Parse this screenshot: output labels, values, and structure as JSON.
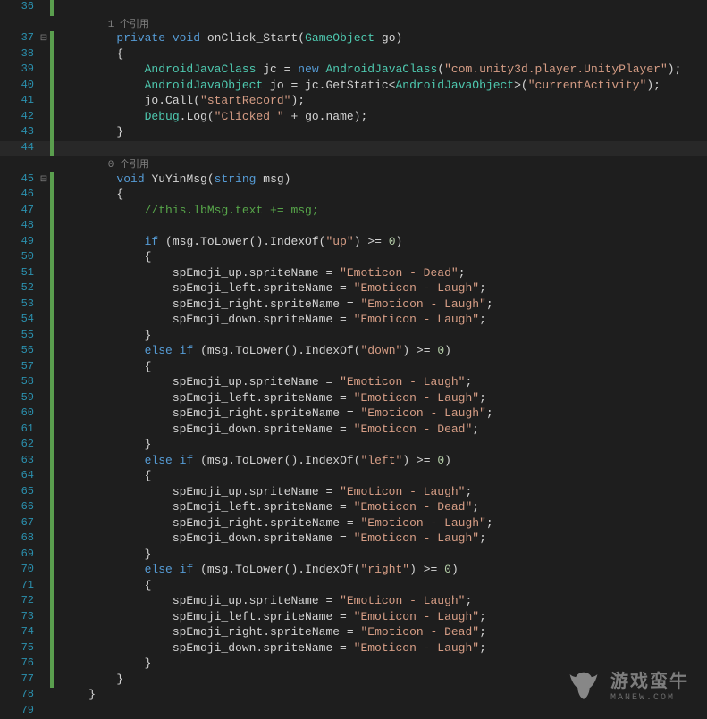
{
  "refs": {
    "r1": "1 个引用",
    "r0": "0 个引用"
  },
  "watermark": {
    "main": "游戏蛮牛",
    "sub": "MANEW.COM"
  },
  "lines": [
    {
      "n": "36",
      "fold": "",
      "bar": "g",
      "tokens": []
    },
    {
      "n": "",
      "fold": "",
      "bar": "",
      "ref": "r1",
      "indent": "        "
    },
    {
      "n": "37",
      "fold": "⊟",
      "bar": "g",
      "tokens": [
        {
          "t": "        "
        },
        {
          "t": "private",
          "c": "kw"
        },
        {
          "t": " "
        },
        {
          "t": "void",
          "c": "kw"
        },
        {
          "t": " onClick_Start("
        },
        {
          "t": "GameObject",
          "c": "type"
        },
        {
          "t": " go)"
        }
      ]
    },
    {
      "n": "38",
      "fold": "",
      "bar": "g",
      "tokens": [
        {
          "t": "        {"
        }
      ]
    },
    {
      "n": "39",
      "fold": "",
      "bar": "g",
      "tokens": [
        {
          "t": "            "
        },
        {
          "t": "AndroidJavaClass",
          "c": "type"
        },
        {
          "t": " jc = "
        },
        {
          "t": "new",
          "c": "kw"
        },
        {
          "t": " "
        },
        {
          "t": "AndroidJavaClass",
          "c": "type"
        },
        {
          "t": "("
        },
        {
          "t": "\"com.unity3d.player.UnityPlayer\"",
          "c": "str"
        },
        {
          "t": ");"
        }
      ]
    },
    {
      "n": "40",
      "fold": "",
      "bar": "g",
      "tokens": [
        {
          "t": "            "
        },
        {
          "t": "AndroidJavaObject",
          "c": "type"
        },
        {
          "t": " jo = jc.GetStatic<"
        },
        {
          "t": "AndroidJavaObject",
          "c": "type"
        },
        {
          "t": ">("
        },
        {
          "t": "\"currentActivity\"",
          "c": "str"
        },
        {
          "t": ");"
        }
      ]
    },
    {
      "n": "41",
      "fold": "",
      "bar": "g",
      "tokens": [
        {
          "t": "            jo.Call("
        },
        {
          "t": "\"startRecord\"",
          "c": "str"
        },
        {
          "t": ");"
        }
      ]
    },
    {
      "n": "42",
      "fold": "",
      "bar": "g",
      "tokens": [
        {
          "t": "            "
        },
        {
          "t": "Debug",
          "c": "type"
        },
        {
          "t": ".Log("
        },
        {
          "t": "\"Clicked \"",
          "c": "str"
        },
        {
          "t": " + go.name);"
        }
      ]
    },
    {
      "n": "43",
      "fold": "",
      "bar": "g",
      "tokens": [
        {
          "t": "        }"
        }
      ]
    },
    {
      "n": "44",
      "fold": "",
      "bar": "g",
      "hl": true,
      "tokens": [
        {
          "t": ""
        }
      ]
    },
    {
      "n": "",
      "fold": "",
      "bar": "",
      "ref": "r0",
      "indent": "        "
    },
    {
      "n": "45",
      "fold": "⊟",
      "bar": "g",
      "tokens": [
        {
          "t": "        "
        },
        {
          "t": "void",
          "c": "kw"
        },
        {
          "t": " YuYinMsg("
        },
        {
          "t": "string",
          "c": "kw"
        },
        {
          "t": " msg)"
        }
      ]
    },
    {
      "n": "46",
      "fold": "",
      "bar": "g",
      "tokens": [
        {
          "t": "        {"
        }
      ]
    },
    {
      "n": "47",
      "fold": "",
      "bar": "g",
      "tokens": [
        {
          "t": "            "
        },
        {
          "t": "//this.lbMsg.text += msg;",
          "c": "comment"
        }
      ]
    },
    {
      "n": "48",
      "fold": "",
      "bar": "g",
      "tokens": [
        {
          "t": ""
        }
      ]
    },
    {
      "n": "49",
      "fold": "",
      "bar": "g",
      "tokens": [
        {
          "t": "            "
        },
        {
          "t": "if",
          "c": "kw"
        },
        {
          "t": " (msg.ToLower().IndexOf("
        },
        {
          "t": "\"up\"",
          "c": "str"
        },
        {
          "t": ") >= "
        },
        {
          "t": "0",
          "c": "num"
        },
        {
          "t": ")"
        }
      ]
    },
    {
      "n": "50",
      "fold": "",
      "bar": "g",
      "tokens": [
        {
          "t": "            {"
        }
      ]
    },
    {
      "n": "51",
      "fold": "",
      "bar": "g",
      "tokens": [
        {
          "t": "                spEmoji_up.spriteName = "
        },
        {
          "t": "\"Emoticon - Dead\"",
          "c": "str"
        },
        {
          "t": ";"
        }
      ]
    },
    {
      "n": "52",
      "fold": "",
      "bar": "g",
      "tokens": [
        {
          "t": "                spEmoji_left.spriteName = "
        },
        {
          "t": "\"Emoticon - Laugh\"",
          "c": "str"
        },
        {
          "t": ";"
        }
      ]
    },
    {
      "n": "53",
      "fold": "",
      "bar": "g",
      "tokens": [
        {
          "t": "                spEmoji_right.spriteName = "
        },
        {
          "t": "\"Emoticon - Laugh\"",
          "c": "str"
        },
        {
          "t": ";"
        }
      ]
    },
    {
      "n": "54",
      "fold": "",
      "bar": "g",
      "tokens": [
        {
          "t": "                spEmoji_down.spriteName = "
        },
        {
          "t": "\"Emoticon - Laugh\"",
          "c": "str"
        },
        {
          "t": ";"
        }
      ]
    },
    {
      "n": "55",
      "fold": "",
      "bar": "g",
      "tokens": [
        {
          "t": "            }"
        }
      ]
    },
    {
      "n": "56",
      "fold": "",
      "bar": "g",
      "tokens": [
        {
          "t": "            "
        },
        {
          "t": "else",
          "c": "kw"
        },
        {
          "t": " "
        },
        {
          "t": "if",
          "c": "kw"
        },
        {
          "t": " (msg.ToLower().IndexOf("
        },
        {
          "t": "\"down\"",
          "c": "str"
        },
        {
          "t": ") >= "
        },
        {
          "t": "0",
          "c": "num"
        },
        {
          "t": ")"
        }
      ]
    },
    {
      "n": "57",
      "fold": "",
      "bar": "g",
      "tokens": [
        {
          "t": "            {"
        }
      ]
    },
    {
      "n": "58",
      "fold": "",
      "bar": "g",
      "tokens": [
        {
          "t": "                spEmoji_up.spriteName = "
        },
        {
          "t": "\"Emoticon - Laugh\"",
          "c": "str"
        },
        {
          "t": ";"
        }
      ]
    },
    {
      "n": "59",
      "fold": "",
      "bar": "g",
      "tokens": [
        {
          "t": "                spEmoji_left.spriteName = "
        },
        {
          "t": "\"Emoticon - Laugh\"",
          "c": "str"
        },
        {
          "t": ";"
        }
      ]
    },
    {
      "n": "60",
      "fold": "",
      "bar": "g",
      "tokens": [
        {
          "t": "                spEmoji_right.spriteName = "
        },
        {
          "t": "\"Emoticon - Laugh\"",
          "c": "str"
        },
        {
          "t": ";"
        }
      ]
    },
    {
      "n": "61",
      "fold": "",
      "bar": "g",
      "tokens": [
        {
          "t": "                spEmoji_down.spriteName = "
        },
        {
          "t": "\"Emoticon - Dead\"",
          "c": "str"
        },
        {
          "t": ";"
        }
      ]
    },
    {
      "n": "62",
      "fold": "",
      "bar": "g",
      "tokens": [
        {
          "t": "            }"
        }
      ]
    },
    {
      "n": "63",
      "fold": "",
      "bar": "g",
      "tokens": [
        {
          "t": "            "
        },
        {
          "t": "else",
          "c": "kw"
        },
        {
          "t": " "
        },
        {
          "t": "if",
          "c": "kw"
        },
        {
          "t": " (msg.ToLower().IndexOf("
        },
        {
          "t": "\"left\"",
          "c": "str"
        },
        {
          "t": ") >= "
        },
        {
          "t": "0",
          "c": "num"
        },
        {
          "t": ")"
        }
      ]
    },
    {
      "n": "64",
      "fold": "",
      "bar": "g",
      "tokens": [
        {
          "t": "            {"
        }
      ]
    },
    {
      "n": "65",
      "fold": "",
      "bar": "g",
      "tokens": [
        {
          "t": "                spEmoji_up.spriteName = "
        },
        {
          "t": "\"Emoticon - Laugh\"",
          "c": "str"
        },
        {
          "t": ";"
        }
      ]
    },
    {
      "n": "66",
      "fold": "",
      "bar": "g",
      "tokens": [
        {
          "t": "                spEmoji_left.spriteName = "
        },
        {
          "t": "\"Emoticon - Dead\"",
          "c": "str"
        },
        {
          "t": ";"
        }
      ]
    },
    {
      "n": "67",
      "fold": "",
      "bar": "g",
      "tokens": [
        {
          "t": "                spEmoji_right.spriteName = "
        },
        {
          "t": "\"Emoticon - Laugh\"",
          "c": "str"
        },
        {
          "t": ";"
        }
      ]
    },
    {
      "n": "68",
      "fold": "",
      "bar": "g",
      "tokens": [
        {
          "t": "                spEmoji_down.spriteName = "
        },
        {
          "t": "\"Emoticon - Laugh\"",
          "c": "str"
        },
        {
          "t": ";"
        }
      ]
    },
    {
      "n": "69",
      "fold": "",
      "bar": "g",
      "tokens": [
        {
          "t": "            }"
        }
      ]
    },
    {
      "n": "70",
      "fold": "",
      "bar": "g",
      "tokens": [
        {
          "t": "            "
        },
        {
          "t": "else",
          "c": "kw"
        },
        {
          "t": " "
        },
        {
          "t": "if",
          "c": "kw"
        },
        {
          "t": " (msg.ToLower().IndexOf("
        },
        {
          "t": "\"right\"",
          "c": "str"
        },
        {
          "t": ") >= "
        },
        {
          "t": "0",
          "c": "num"
        },
        {
          "t": ")"
        }
      ]
    },
    {
      "n": "71",
      "fold": "",
      "bar": "g",
      "tokens": [
        {
          "t": "            {"
        }
      ]
    },
    {
      "n": "72",
      "fold": "",
      "bar": "g",
      "tokens": [
        {
          "t": "                spEmoji_up.spriteName = "
        },
        {
          "t": "\"Emoticon - Laugh\"",
          "c": "str"
        },
        {
          "t": ";"
        }
      ]
    },
    {
      "n": "73",
      "fold": "",
      "bar": "g",
      "tokens": [
        {
          "t": "                spEmoji_left.spriteName = "
        },
        {
          "t": "\"Emoticon - Laugh\"",
          "c": "str"
        },
        {
          "t": ";"
        }
      ]
    },
    {
      "n": "74",
      "fold": "",
      "bar": "g",
      "tokens": [
        {
          "t": "                spEmoji_right.spriteName = "
        },
        {
          "t": "\"Emoticon - Dead\"",
          "c": "str"
        },
        {
          "t": ";"
        }
      ]
    },
    {
      "n": "75",
      "fold": "",
      "bar": "g",
      "tokens": [
        {
          "t": "                spEmoji_down.spriteName = "
        },
        {
          "t": "\"Emoticon - Laugh\"",
          "c": "str"
        },
        {
          "t": ";"
        }
      ]
    },
    {
      "n": "76",
      "fold": "",
      "bar": "g",
      "tokens": [
        {
          "t": "            }"
        }
      ]
    },
    {
      "n": "77",
      "fold": "",
      "bar": "g",
      "tokens": [
        {
          "t": "        }"
        }
      ]
    },
    {
      "n": "78",
      "fold": "",
      "bar": "",
      "tokens": [
        {
          "t": "    }"
        }
      ]
    },
    {
      "n": "79",
      "fold": "",
      "bar": "",
      "tokens": [
        {
          "t": ""
        }
      ]
    }
  ]
}
